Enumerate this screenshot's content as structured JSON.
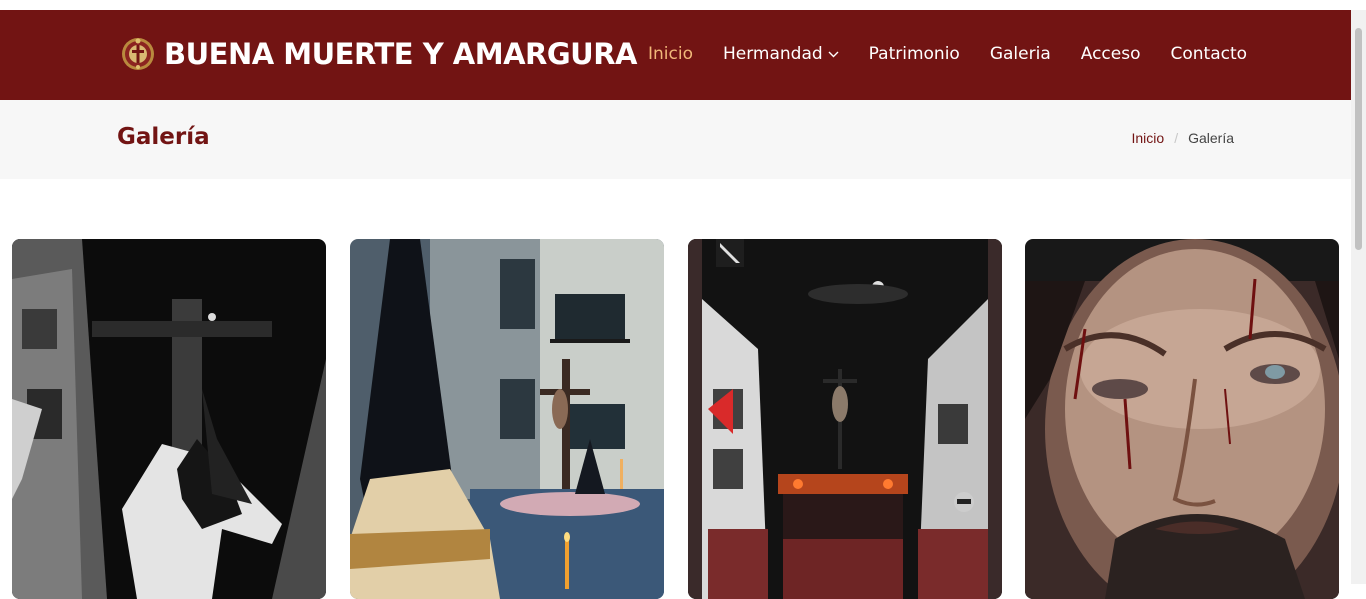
{
  "site": {
    "brand": "BUENA MUERTE Y AMARGURA",
    "logo_icon": "brotherhood-crest-icon"
  },
  "nav": {
    "items": [
      {
        "label": "Inicio",
        "active": true
      },
      {
        "label": "Hermandad",
        "has_dropdown": true
      },
      {
        "label": "Patrimonio"
      },
      {
        "label": "Galeria"
      },
      {
        "label": "Acceso"
      },
      {
        "label": "Contacto"
      }
    ]
  },
  "page": {
    "title": "Galería",
    "breadcrumb": {
      "home": "Inicio",
      "separator": "/",
      "current": "Galería"
    }
  },
  "gallery": {
    "items": [
      {
        "subject": "nazarene-carrying-cross-photo"
      },
      {
        "subject": "hooded-nazarene-with-crucifix-photo"
      },
      {
        "subject": "night-procession-float-photo"
      },
      {
        "subject": "christ-face-closeup-photo"
      }
    ]
  },
  "colors": {
    "primary": "#721413",
    "active_link": "#f1b879",
    "page_header_bg": "#f7f7f7"
  }
}
